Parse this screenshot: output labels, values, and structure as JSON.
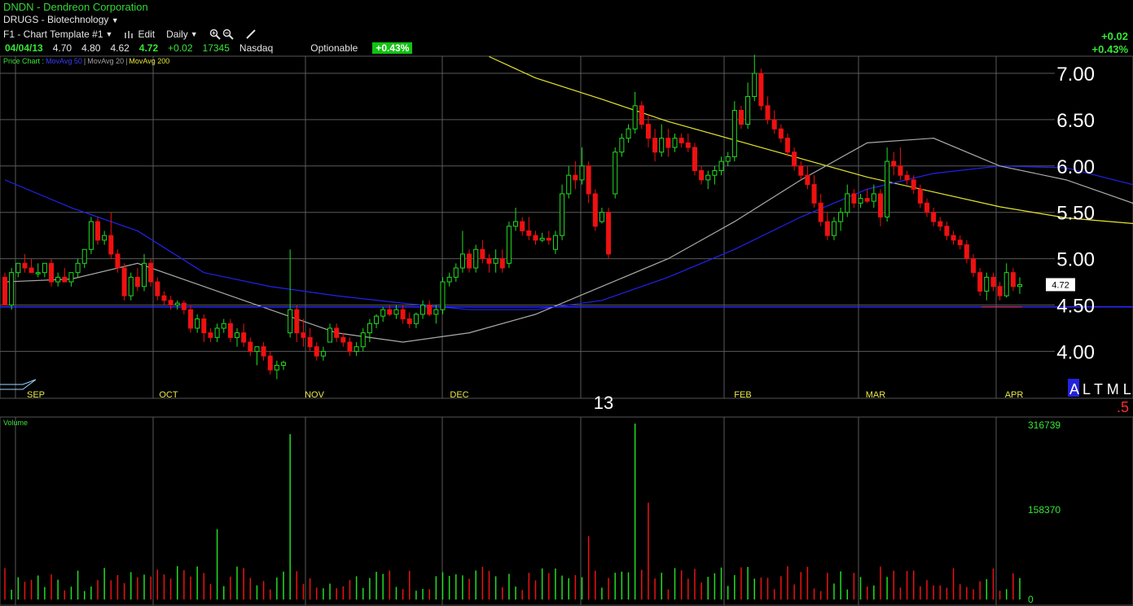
{
  "header": {
    "title": "DNDN - Dendreon Corporation",
    "group": "DRUGS - Biotechnology",
    "template_label": "F1 - Chart Template #1",
    "edit_label": "Edit",
    "period_label": "Daily"
  },
  "quote": {
    "date": "04/04/13",
    "open": "4.70",
    "high": "4.80",
    "low": "4.62",
    "last": "4.72",
    "change": "+0.02",
    "volume": "17345",
    "exchange": "Nasdaq",
    "optionable": "Optionable",
    "pct_change": "+0.43%"
  },
  "legend": {
    "price": "Price Chart :",
    "ma50": "MovAvg 50",
    "ma20": "MovAvg 20",
    "ma200": "MovAvg 200"
  },
  "right_change": {
    "abs": "+0.02",
    "pct": "+0.43%"
  },
  "bottom": {
    "year": "13",
    "altml": "A L T M L",
    "fraction": ".5"
  },
  "volume_label": "Volume",
  "colors": {
    "up": "#22dd22",
    "down": "#ee1111",
    "ma50": "#2222ee",
    "ma20": "#aaaaaa",
    "ma200": "#e6e62e",
    "grid": "#5a5a5a"
  },
  "chart_data": [
    {
      "type": "candlestick",
      "title": "DNDN - Dendreon Corporation",
      "ylim": [
        3.65,
        7.2
      ],
      "y_ticks": [
        "7.00",
        "6.50",
        "6.00",
        "5.50",
        "5.00",
        "4.50",
        "4.00"
      ],
      "x_months": [
        "SEP",
        "OCT",
        "NOV",
        "DEC",
        "FEB",
        "MAR",
        "APR"
      ],
      "year_marker": "13",
      "last_price_label": "4.72",
      "support_line": 4.48,
      "ohlc": [
        [
          4.8,
          4.85,
          4.55,
          4.5
        ],
        [
          4.5,
          4.9,
          4.45,
          4.85
        ],
        [
          4.85,
          4.95,
          4.8,
          4.95
        ],
        [
          4.95,
          5.05,
          4.85,
          4.9
        ],
        [
          4.9,
          5.0,
          4.85,
          4.85
        ],
        [
          4.85,
          4.95,
          4.8,
          4.85
        ],
        [
          4.85,
          4.95,
          4.8,
          4.95
        ],
        [
          4.95,
          5.0,
          4.7,
          4.75
        ],
        [
          4.75,
          4.85,
          4.7,
          4.8
        ],
        [
          4.8,
          4.9,
          4.75,
          4.75
        ],
        [
          4.75,
          4.85,
          4.7,
          4.85
        ],
        [
          4.85,
          5.0,
          4.8,
          4.95
        ],
        [
          4.95,
          5.1,
          4.9,
          5.1
        ],
        [
          5.1,
          5.45,
          5.05,
          5.4
        ],
        [
          5.4,
          5.45,
          5.15,
          5.2
        ],
        [
          5.2,
          5.3,
          5.15,
          5.25
        ],
        [
          5.25,
          5.5,
          5.0,
          5.05
        ],
        [
          5.05,
          5.1,
          4.85,
          4.9
        ],
        [
          4.9,
          4.95,
          4.55,
          4.6
        ],
        [
          4.6,
          4.85,
          4.55,
          4.8
        ],
        [
          4.8,
          4.9,
          4.65,
          4.7
        ],
        [
          4.7,
          5.05,
          4.65,
          4.95
        ],
        [
          4.95,
          5.0,
          4.7,
          4.75
        ],
        [
          4.75,
          4.8,
          4.55,
          4.6
        ],
        [
          4.6,
          4.65,
          4.5,
          4.55
        ],
        [
          4.55,
          4.6,
          4.45,
          4.5
        ],
        [
          4.5,
          4.55,
          4.45,
          4.52
        ],
        [
          4.52,
          4.55,
          4.4,
          4.45
        ],
        [
          4.45,
          4.5,
          4.2,
          4.25
        ],
        [
          4.25,
          4.4,
          4.2,
          4.35
        ],
        [
          4.35,
          4.4,
          4.1,
          4.2
        ],
        [
          4.2,
          4.25,
          4.1,
          4.15
        ],
        [
          4.15,
          4.3,
          4.1,
          4.25
        ],
        [
          4.25,
          4.35,
          4.2,
          4.3
        ],
        [
          4.3,
          4.35,
          4.1,
          4.15
        ],
        [
          4.15,
          4.25,
          4.05,
          4.2
        ],
        [
          4.2,
          4.3,
          4.05,
          4.1
        ],
        [
          4.1,
          4.15,
          3.95,
          4.0
        ],
        [
          4.0,
          4.05,
          3.85,
          4.05
        ],
        [
          4.05,
          4.1,
          3.9,
          3.95
        ],
        [
          3.95,
          4.0,
          3.75,
          3.8
        ],
        [
          3.8,
          3.9,
          3.7,
          3.85
        ],
        [
          3.85,
          3.9,
          3.8,
          3.88
        ],
        [
          4.2,
          5.1,
          4.15,
          4.45
        ],
        [
          4.45,
          4.5,
          4.1,
          4.2
        ],
        [
          4.2,
          4.35,
          4.05,
          4.15
        ],
        [
          4.15,
          4.25,
          4.0,
          4.05
        ],
        [
          4.05,
          4.1,
          3.9,
          3.95
        ],
        [
          3.95,
          4.05,
          3.9,
          4.0
        ],
        [
          4.1,
          4.3,
          4.1,
          4.25
        ],
        [
          4.25,
          4.3,
          4.1,
          4.15
        ],
        [
          4.15,
          4.2,
          4.05,
          4.1
        ],
        [
          4.1,
          4.15,
          3.95,
          4.0
        ],
        [
          4.0,
          4.1,
          3.95,
          4.05
        ],
        [
          4.05,
          4.25,
          4.0,
          4.2
        ],
        [
          4.2,
          4.35,
          4.1,
          4.3
        ],
        [
          4.3,
          4.4,
          4.25,
          4.38
        ],
        [
          4.38,
          4.48,
          4.32,
          4.45
        ],
        [
          4.45,
          4.5,
          4.38,
          4.4
        ],
        [
          4.4,
          4.5,
          4.35,
          4.45
        ],
        [
          4.45,
          4.5,
          4.3,
          4.35
        ],
        [
          4.35,
          4.42,
          4.25,
          4.3
        ],
        [
          4.3,
          4.42,
          4.25,
          4.4
        ],
        [
          4.4,
          4.55,
          4.35,
          4.5
        ],
        [
          4.5,
          4.55,
          4.38,
          4.4
        ],
        [
          4.4,
          4.5,
          4.3,
          4.45
        ],
        [
          4.45,
          4.8,
          4.4,
          4.75
        ],
        [
          4.75,
          4.85,
          4.7,
          4.8
        ],
        [
          4.8,
          4.95,
          4.75,
          4.9
        ],
        [
          4.9,
          5.3,
          4.85,
          5.05
        ],
        [
          5.05,
          5.1,
          4.85,
          4.9
        ],
        [
          4.9,
          5.15,
          4.85,
          5.1
        ],
        [
          5.1,
          5.2,
          4.95,
          5.0
        ],
        [
          5.0,
          5.05,
          4.85,
          4.95
        ],
        [
          4.95,
          5.1,
          4.85,
          5.0
        ],
        [
          5.0,
          5.1,
          4.85,
          4.9
        ],
        [
          4.95,
          5.4,
          4.9,
          5.35
        ],
        [
          5.35,
          5.55,
          5.3,
          5.4
        ],
        [
          5.4,
          5.45,
          5.25,
          5.3
        ],
        [
          5.3,
          5.45,
          5.2,
          5.25
        ],
        [
          5.25,
          5.3,
          5.15,
          5.2
        ],
        [
          5.2,
          5.28,
          5.18,
          5.22
        ],
        [
          5.22,
          5.3,
          5.15,
          5.2
        ],
        [
          5.1,
          5.3,
          5.05,
          5.25
        ],
        [
          5.25,
          5.8,
          5.2,
          5.7
        ],
        [
          5.7,
          6.0,
          5.65,
          5.9
        ],
        [
          5.9,
          6.05,
          5.75,
          5.85
        ],
        [
          5.85,
          6.2,
          5.8,
          6.0
        ],
        [
          6.0,
          6.05,
          5.6,
          5.7
        ],
        [
          5.7,
          5.75,
          5.3,
          5.35
        ],
        [
          5.4,
          5.55,
          5.38,
          5.5
        ],
        [
          5.5,
          5.55,
          5.0,
          5.05
        ],
        [
          5.7,
          6.2,
          5.65,
          6.15
        ],
        [
          6.15,
          6.35,
          6.1,
          6.3
        ],
        [
          6.3,
          6.45,
          6.25,
          6.4
        ],
        [
          6.4,
          6.8,
          6.35,
          6.65
        ],
        [
          6.65,
          6.7,
          6.4,
          6.45
        ],
        [
          6.45,
          6.55,
          6.2,
          6.3
        ],
        [
          6.3,
          6.4,
          6.05,
          6.15
        ],
        [
          6.15,
          6.45,
          6.1,
          6.3
        ],
        [
          6.3,
          6.4,
          6.1,
          6.2
        ],
        [
          6.2,
          6.35,
          6.15,
          6.3
        ],
        [
          6.3,
          6.35,
          6.2,
          6.25
        ],
        [
          6.25,
          6.35,
          6.15,
          6.2
        ],
        [
          6.2,
          6.25,
          5.9,
          5.95
        ],
        [
          5.95,
          6.0,
          5.8,
          5.85
        ],
        [
          5.85,
          5.95,
          5.75,
          5.9
        ],
        [
          5.9,
          6.0,
          5.8,
          5.95
        ],
        [
          5.95,
          6.1,
          5.9,
          6.05
        ],
        [
          6.05,
          6.15,
          6.0,
          6.1
        ],
        [
          6.1,
          6.7,
          6.05,
          6.6
        ],
        [
          6.6,
          6.65,
          6.4,
          6.45
        ],
        [
          6.45,
          6.9,
          6.4,
          6.75
        ],
        [
          6.75,
          7.2,
          6.7,
          7.0
        ],
        [
          7.0,
          7.05,
          6.6,
          6.65
        ],
        [
          6.65,
          6.75,
          6.45,
          6.5
        ],
        [
          6.5,
          6.6,
          6.35,
          6.4
        ],
        [
          6.4,
          6.45,
          6.25,
          6.3
        ],
        [
          6.3,
          6.35,
          6.1,
          6.15
        ],
        [
          6.15,
          6.2,
          5.95,
          6.0
        ],
        [
          6.0,
          6.05,
          5.85,
          5.9
        ],
        [
          5.9,
          6.0,
          5.75,
          5.8
        ],
        [
          5.8,
          5.9,
          5.55,
          5.6
        ],
        [
          5.6,
          5.7,
          5.35,
          5.4
        ],
        [
          5.4,
          5.5,
          5.2,
          5.25
        ],
        [
          5.25,
          5.45,
          5.2,
          5.4
        ],
        [
          5.4,
          5.55,
          5.3,
          5.5
        ],
        [
          5.5,
          5.8,
          5.45,
          5.7
        ],
        [
          5.7,
          5.75,
          5.55,
          5.6
        ],
        [
          5.6,
          5.7,
          5.55,
          5.65
        ],
        [
          5.65,
          5.75,
          5.6,
          5.62
        ],
        [
          5.62,
          5.8,
          5.55,
          5.7
        ],
        [
          5.7,
          5.75,
          5.35,
          5.45
        ],
        [
          5.45,
          6.2,
          5.4,
          6.05
        ],
        [
          6.05,
          6.15,
          5.9,
          6.0
        ],
        [
          6.0,
          6.2,
          5.85,
          5.9
        ],
        [
          5.9,
          5.95,
          5.8,
          5.85
        ],
        [
          5.85,
          5.9,
          5.7,
          5.75
        ],
        [
          5.75,
          5.8,
          5.55,
          5.6
        ],
        [
          5.6,
          5.65,
          5.45,
          5.5
        ],
        [
          5.5,
          5.55,
          5.35,
          5.4
        ],
        [
          5.4,
          5.45,
          5.3,
          5.35
        ],
        [
          5.35,
          5.4,
          5.2,
          5.25
        ],
        [
          5.25,
          5.3,
          5.15,
          5.2
        ],
        [
          5.2,
          5.25,
          5.1,
          5.15
        ],
        [
          5.15,
          5.2,
          4.95,
          5.0
        ],
        [
          5.0,
          5.05,
          4.8,
          4.85
        ],
        [
          4.85,
          4.9,
          4.6,
          4.65
        ],
        [
          4.65,
          4.85,
          4.55,
          4.8
        ],
        [
          4.8,
          4.85,
          4.65,
          4.7
        ],
        [
          4.7,
          4.75,
          4.55,
          4.6
        ],
        [
          4.6,
          4.95,
          4.58,
          4.85
        ],
        [
          4.85,
          4.9,
          4.65,
          4.7
        ],
        [
          4.7,
          4.8,
          4.62,
          4.72
        ]
      ],
      "moving_averages": [
        {
          "name": "MovAvg 200",
          "color": "#e6e62e",
          "points": [
            [
              73,
              7.18
            ],
            [
              80,
              6.95
            ],
            [
              90,
              6.72
            ],
            [
              100,
              6.48
            ],
            [
              110,
              6.28
            ],
            [
              120,
              6.08
            ],
            [
              130,
              5.88
            ],
            [
              140,
              5.72
            ],
            [
              150,
              5.56
            ],
            [
              160,
              5.44
            ],
            [
              170,
              5.38
            ],
            [
              175,
              5.32
            ]
          ]
        },
        {
          "name": "MovAvg 50",
          "color": "#2222ee",
          "points": [
            [
              0,
              5.85
            ],
            [
              10,
              5.55
            ],
            [
              20,
              5.3
            ],
            [
              30,
              4.85
            ],
            [
              40,
              4.7
            ],
            [
              50,
              4.6
            ],
            [
              60,
              4.52
            ],
            [
              70,
              4.45
            ],
            [
              80,
              4.45
            ],
            [
              90,
              4.55
            ],
            [
              100,
              4.8
            ],
            [
              110,
              5.1
            ],
            [
              120,
              5.45
            ],
            [
              130,
              5.75
            ],
            [
              140,
              5.92
            ],
            [
              150,
              6.0
            ],
            [
              160,
              5.98
            ],
            [
              170,
              5.8
            ],
            [
              175,
              5.68
            ]
          ]
        },
        {
          "name": "MovAvg 20",
          "color": "#aaaaaa",
          "points": [
            [
              0,
              4.75
            ],
            [
              10,
              4.78
            ],
            [
              20,
              4.95
            ],
            [
              30,
              4.7
            ],
            [
              40,
              4.45
            ],
            [
              50,
              4.2
            ],
            [
              60,
              4.1
            ],
            [
              70,
              4.2
            ],
            [
              80,
              4.4
            ],
            [
              90,
              4.7
            ],
            [
              100,
              5.0
            ],
            [
              110,
              5.4
            ],
            [
              120,
              5.85
            ],
            [
              130,
              6.25
            ],
            [
              140,
              6.3
            ],
            [
              150,
              6.0
            ],
            [
              160,
              5.85
            ],
            [
              170,
              5.6
            ],
            [
              175,
              5.15
            ]
          ]
        }
      ]
    },
    {
      "type": "bar",
      "title": "Volume",
      "y_ticks": [
        "316739",
        "158370",
        "0"
      ],
      "ylim": [
        0,
        316739
      ]
    }
  ]
}
